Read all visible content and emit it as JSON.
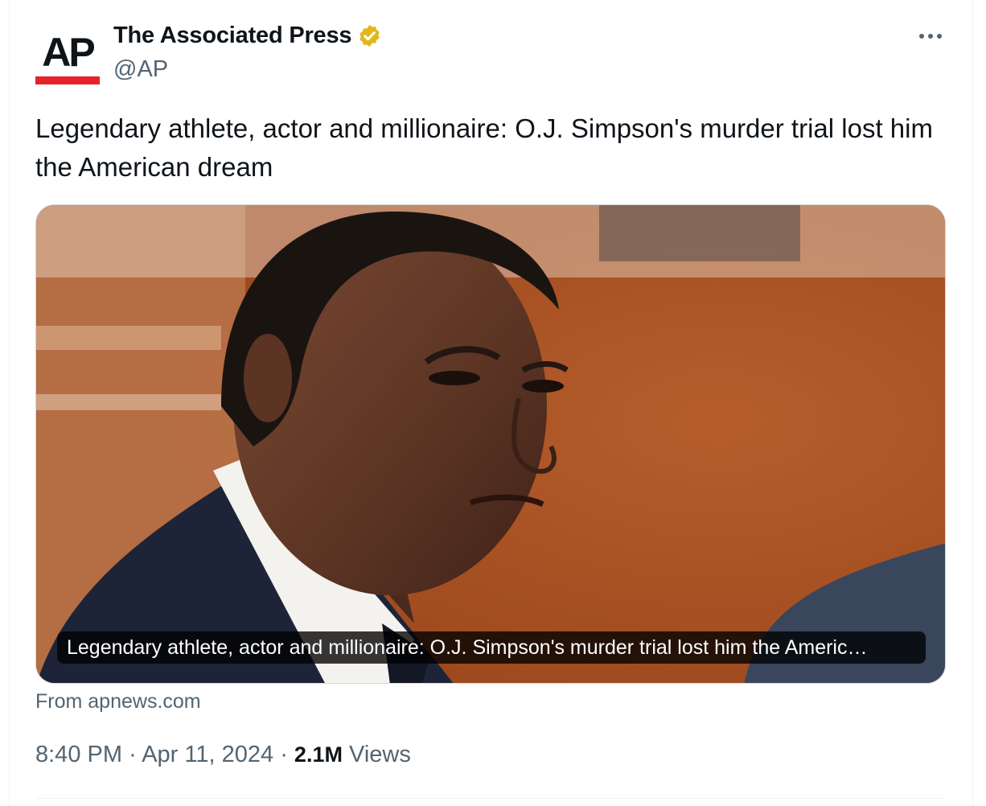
{
  "author": {
    "logo_text": "AP",
    "name": "The Associated Press",
    "handle": "@AP",
    "verified_color": "#e2b719",
    "logo_bar_color": "#e8222b"
  },
  "tweet": {
    "text": "Legendary athlete, actor and millionaire: O.J. Simpson's murder trial lost him the American dream"
  },
  "card": {
    "caption": "Legendary athlete, actor and millionaire: O.J. Simpson's murder trial lost him the Americ…",
    "source": "From apnews.com"
  },
  "meta": {
    "time": "8:40 PM",
    "date": "Apr 11, 2024",
    "separator": "·",
    "views_count": "2.1M",
    "views_label": "Views"
  }
}
